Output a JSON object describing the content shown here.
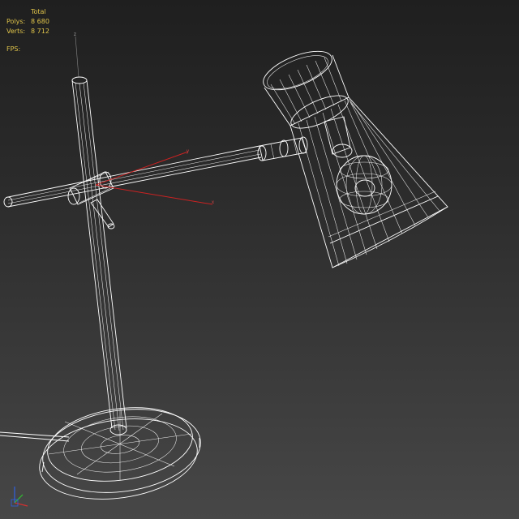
{
  "stats": {
    "header": "Total",
    "polys_label": "Polys:",
    "polys_value": "8 680",
    "verts_label": "Verts:",
    "verts_value": "8 712",
    "fps_label": "FPS:"
  },
  "gizmo": {
    "z_label": "z",
    "y_label": "y",
    "x_label": "x"
  },
  "colors": {
    "wireframe": "#ffffff",
    "stats_text": "#e0c44a",
    "gizmo_x": "#cc2222",
    "axis_tripod_x": "#d23030",
    "axis_tripod_y": "#30c030",
    "axis_tripod_z": "#3060e0"
  }
}
